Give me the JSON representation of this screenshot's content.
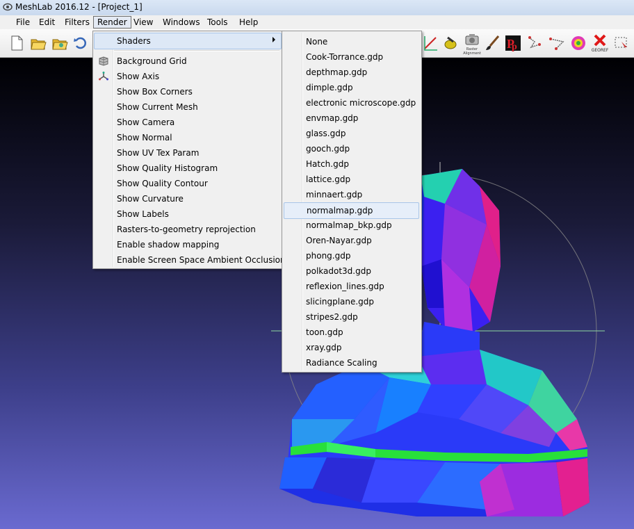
{
  "window": {
    "title": "MeshLab 2016.12 - [Project_1]"
  },
  "menubar": {
    "items": [
      "File",
      "Edit",
      "Filters",
      "Render",
      "View",
      "Windows",
      "Tools",
      "Help"
    ],
    "active": "Render"
  },
  "toolbar": {
    "icons": [
      "new-document-icon",
      "open-folder-icon",
      "open-project-icon",
      "reload-icon",
      "measure-icon",
      "paint-icon",
      "camera-icon",
      "paintbrush-icon",
      "pickpoints-icon",
      "align-icon",
      "align-2-icon",
      "texture-icon",
      "georef-icon",
      "select-icon"
    ],
    "camera_caption": "Raster Alignment",
    "georef_caption": "GEOREF"
  },
  "render_menu": {
    "shaders_label": "Shaders",
    "items": [
      {
        "label": "Background Grid",
        "icon": "grid-icon"
      },
      {
        "label": "Show Axis",
        "icon": "axis-icon"
      },
      {
        "label": "Show Box Corners"
      },
      {
        "label": "Show Current Mesh"
      },
      {
        "label": "Show Camera"
      },
      {
        "label": "Show Normal"
      },
      {
        "label": "Show UV Tex Param"
      },
      {
        "label": "Show Quality Histogram"
      },
      {
        "label": "Show Quality Contour"
      },
      {
        "label": "Show Curvature"
      },
      {
        "label": "Show Labels"
      },
      {
        "label": "Rasters-to-geometry reprojection"
      },
      {
        "label": "Enable shadow mapping"
      },
      {
        "label": "Enable Screen Space Ambient Occlusion"
      }
    ]
  },
  "shader_menu": {
    "selected": "normalmap.gdp",
    "items": [
      "None",
      "Cook-Torrance.gdp",
      "depthmap.gdp",
      "dimple.gdp",
      "electronic microscope.gdp",
      "envmap.gdp",
      "glass.gdp",
      "gooch.gdp",
      "Hatch.gdp",
      "lattice.gdp",
      "minnaert.gdp",
      "normalmap.gdp",
      "normalmap_bkp.gdp",
      "Oren-Nayar.gdp",
      "phong.gdp",
      "polkadot3d.gdp",
      "reflexion_lines.gdp",
      "slicingplane.gdp",
      "stripes2.gdp",
      "toon.gdp",
      "xray.gdp",
      "Radiance Scaling"
    ]
  },
  "colors": {
    "menu_bg": "#f0f0f0",
    "highlight": "#dde8f6",
    "highlight_border": "#a8c5e8"
  }
}
